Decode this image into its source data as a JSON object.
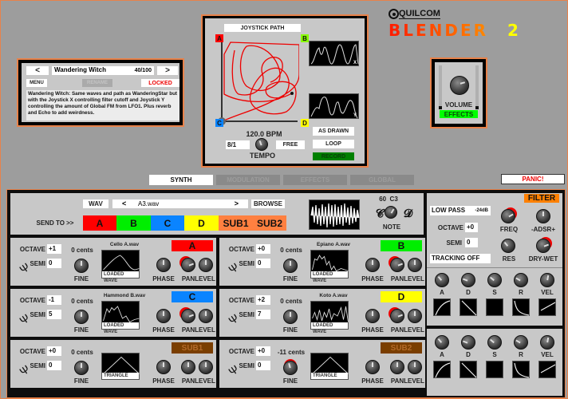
{
  "brand": {
    "company": "QUILCOM",
    "product": "BLENDER",
    "version": "2"
  },
  "preset": {
    "prev": "<",
    "next": ">",
    "name": "Wandering Witch",
    "count": "40/100",
    "menu": "MENU",
    "rename": "RENAME",
    "locked": "LOCKED",
    "description": "Wandering Witch: Same waves and path as WanderingStar but with the Joystick X controlling filter cutoff and Joystick Y controlling the amount of Global FM from LFO1. Plus reverb and Echo to add weirdness."
  },
  "joystick": {
    "title": "JOYSTICK PATH",
    "corners": {
      "a": "A",
      "b": "B",
      "c": "C",
      "d": "D"
    },
    "bpm": "120.0 BPM",
    "division": "8/1",
    "free": "FREE",
    "tempo": "TEMPO",
    "as_drawn": "AS DRAWN",
    "loop": "LOOP",
    "record": "RECORD",
    "x_label": "X",
    "y_label": "Y"
  },
  "volume": {
    "label": "VOLUME",
    "effects": "EFFECTS",
    "level": 0.7
  },
  "tabs": [
    {
      "label": "SYNTH",
      "active": true
    },
    {
      "label": "MODULATION",
      "active": false
    },
    {
      "label": "EFFECTS",
      "active": false
    },
    {
      "label": "GLOBAL",
      "active": false
    }
  ],
  "panic": "PANIC!",
  "wav": {
    "label": "WAV",
    "prev": "<",
    "file": "A3.wav",
    "next": ">",
    "browse": "BROWSE",
    "send_to": "SEND TO >>",
    "targets": [
      "A",
      "B",
      "C",
      "D",
      "SUB1",
      "SUB2"
    ],
    "note_value": "60  C3",
    "note": "NOTE"
  },
  "colors": {
    "a": "#ff0000",
    "b": "#00ee00",
    "c": "#0a84ff",
    "d": "#ffff00",
    "sub": "#ff8040",
    "subbadge": "#7a3e00",
    "orange": "#e8824a",
    "record": "#008000",
    "effects": "#00ff00"
  },
  "oscillators": [
    {
      "id": "A",
      "octave": "+1",
      "semi": "0",
      "cents": "0 cents",
      "wave": "Cello A.wav",
      "cap": "LOADED WAVE"
    },
    {
      "id": "B",
      "octave": "+0",
      "semi": "0",
      "cents": "0 cents",
      "wave": "Epiano A.wav",
      "cap": "LOADED WAVE"
    },
    {
      "id": "C",
      "octave": "-1",
      "semi": "5",
      "cents": "0 cents",
      "wave": "Hammond B.wav",
      "cap": "LOADED WAVE"
    },
    {
      "id": "D",
      "octave": "+2",
      "semi": "7",
      "cents": "0 cents",
      "wave": "Koto A.wav",
      "cap": "LOADED WAVE"
    },
    {
      "id": "SUB1",
      "octave": "+0",
      "semi": "0",
      "cents": "0 cents",
      "wave": "",
      "cap": "TRIANGLE"
    },
    {
      "id": "SUB2",
      "octave": "+0",
      "semi": "0",
      "cents": "-11 cents",
      "wave": "",
      "cap": "TRIANGLE"
    }
  ],
  "osc_labels": {
    "octave": "OCTAVE",
    "semi": "SEMI",
    "fine": "FINE",
    "phase": "PHASE",
    "pan": "PAN",
    "level": "LEVEL"
  },
  "filter": {
    "title": "FILTER",
    "type": "LOW PASS",
    "slope": "-24dB",
    "octave_label": "OCTAVE",
    "octave": "+0",
    "semi_label": "SEMI",
    "semi": "0",
    "tracking": "TRACKING OFF",
    "freq": "FREQ",
    "adsr": "-ADSR+",
    "res": "RES",
    "drywet": "DRY-WET"
  },
  "envelopes": {
    "labels": [
      "A",
      "D",
      "S",
      "R",
      "VEL"
    ]
  }
}
